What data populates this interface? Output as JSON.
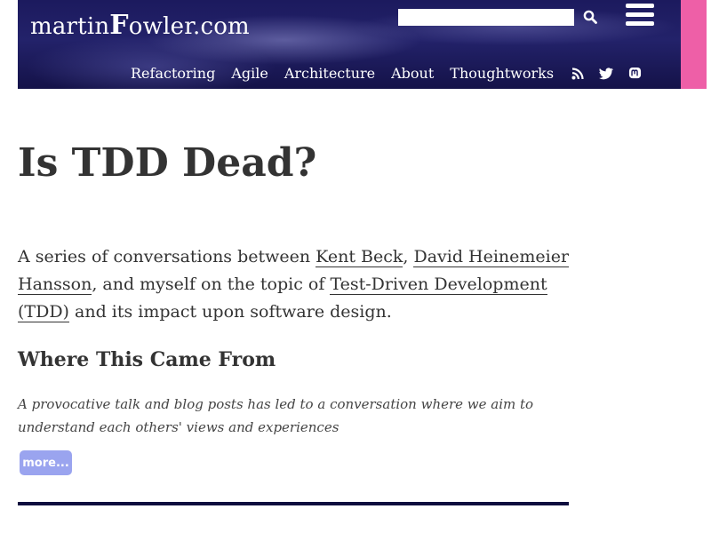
{
  "header": {
    "logo": {
      "prefix": "martin",
      "strong": "F",
      "suffix": "owler.com"
    },
    "search": {
      "value": "",
      "placeholder": ""
    },
    "nav": [
      {
        "label": "Refactoring"
      },
      {
        "label": "Agile"
      },
      {
        "label": "Architecture"
      },
      {
        "label": "About"
      },
      {
        "label": "Thoughtworks"
      }
    ],
    "social_icons": [
      "rss-icon",
      "twitter-icon",
      "mastodon-icon"
    ]
  },
  "article": {
    "title": "Is TDD Dead?",
    "intro": {
      "text1": "A series of conversations between ",
      "link1": "Kent Beck",
      "text2": ", ",
      "link2": "David Heinemeier Hansson",
      "text3": ", and myself on the topic of ",
      "link3": "Test-Driven Development (TDD)",
      "text4": " and its impact upon software design."
    },
    "sections": [
      {
        "title": "Where This Came From",
        "summary": "A provocative talk and blog posts has led to a conversation where we aim to understand each others' views and experiences",
        "more_label": "more..."
      }
    ]
  },
  "colors": {
    "header_bg": "#1c1a5e",
    "accent_pink": "#ee5fa7",
    "more_button": "#9aa4ef",
    "divider": "#0e0d3e",
    "text": "#333333"
  }
}
